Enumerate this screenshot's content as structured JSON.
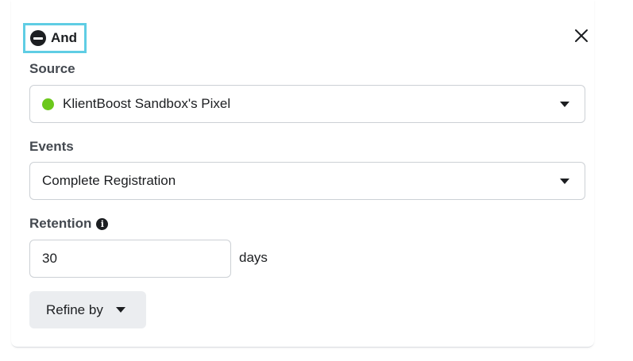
{
  "condition": {
    "label": "And",
    "icon": "minus-circle-icon"
  },
  "close": {
    "icon": "close-icon"
  },
  "source": {
    "label": "Source",
    "selected": "KlientBoost Sandbox's Pixel",
    "status_color": "#6bc81b"
  },
  "events": {
    "label": "Events",
    "selected": "Complete Registration"
  },
  "retention": {
    "label": "Retention",
    "info_icon": "info-icon",
    "value": "30",
    "unit": "days"
  },
  "refine": {
    "label": "Refine by"
  },
  "colors": {
    "focus_outline": "#5fcde4",
    "button_bg": "#ebedf0"
  }
}
